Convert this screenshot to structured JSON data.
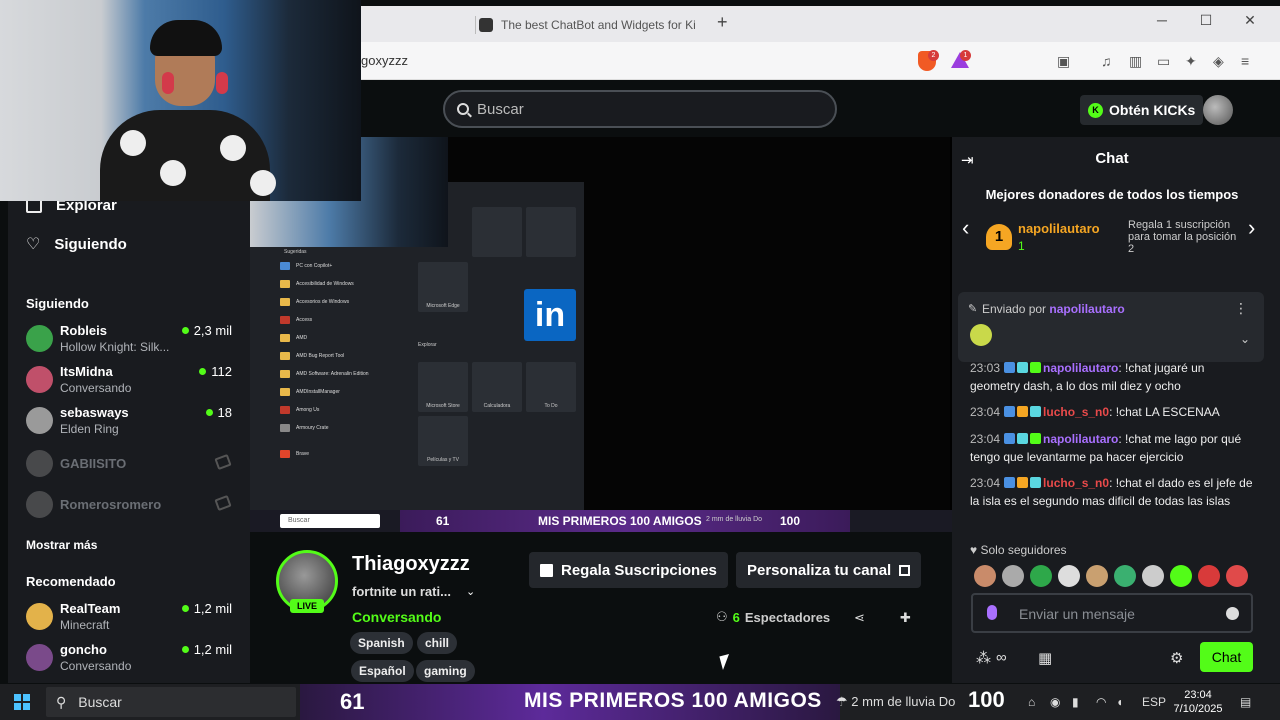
{
  "browser": {
    "tab_title": "The best ChatBot and Widgets for Ki",
    "new_tab": "+",
    "url": "goxyzzz",
    "minimize": "─",
    "maximize": "☐",
    "close": "✕",
    "brave_badge": "2",
    "rewards_badge": "1"
  },
  "header": {
    "search_placeholder": "Buscar",
    "kicks_button": "Obtén KICKs",
    "kicks_logo": "K"
  },
  "sidebar": {
    "explore": "Explorar",
    "following": "Siguiendo",
    "following_title": "Siguiendo",
    "following_channels": [
      {
        "name": "Robleis",
        "sub": "Hollow Knight: Silk...",
        "count": "2,3 mil",
        "avatar_color": "#3aa24a"
      },
      {
        "name": "ItsMidna",
        "sub": "Conversando",
        "count": "112",
        "avatar_color": "#c0506a"
      },
      {
        "name": "sebasways",
        "sub": "Elden Ring",
        "count": "18",
        "avatar_color": "#9a9a9a"
      }
    ],
    "offline_channels": [
      {
        "name": "GABIISITO"
      },
      {
        "name": "Romerosromero"
      }
    ],
    "show_more": "Mostrar más",
    "recommended_title": "Recomendado",
    "recommended_channels": [
      {
        "name": "RealTeam",
        "sub": "Minecraft",
        "count": "1,2 mil",
        "avatar_color": "#e3b24a"
      },
      {
        "name": "goncho",
        "sub": "Conversando",
        "count": "1,2 mil",
        "avatar_color": "#7a4a8a"
      }
    ]
  },
  "stream_overlay": {
    "start_menu_pinned": "Sugeridas",
    "start_menu_items": [
      "PC con Copilot+",
      "Accesibilidad de Windows",
      "Accesorios de Windows",
      "Access",
      "AMD",
      "AMD Bug Report Tool",
      "AMD Software: Adrenalin Edition",
      "AMDInstallManager",
      "Among Us",
      "Armoury Crate",
      "Brave"
    ],
    "tiles": [
      "Microsoft Edge",
      "Microsoft Store",
      "Calculadora",
      "To Do",
      "Películas y TV"
    ],
    "linkedin": "in",
    "explore_label": "Explorar",
    "stream_search": "Buscar",
    "stream_num": "61",
    "stream_banner": "MIS PRIMEROS 100 AMIGOS",
    "stream_100": "100",
    "stream_weather": "2 mm de lluvia Do"
  },
  "channel": {
    "name": "Thiagoxyzzz",
    "live_badge": "LIVE",
    "stream_title": "fortnite un rati...",
    "category": "Conversando",
    "tags": [
      "Spanish",
      "chill",
      "Español",
      "gaming"
    ],
    "subs_button": "Regala Suscripciones",
    "customize_button": "Personaliza tu canal",
    "viewer_count": "6",
    "viewers_label": "Espectadores"
  },
  "chat": {
    "title": "Chat",
    "donors_title": "Mejores donadores de todos los tiempos",
    "donor_rank": "1",
    "donor_name": "napolilautaro",
    "donor_amount": "1",
    "donor_next": "Regala 1 suscripción para tomar la posición 2",
    "pinned_prefix": "Enviado por",
    "pinned_user": "napolilautaro",
    "messages": [
      {
        "time": "23:03",
        "user": "napolilautaro",
        "text": ": !chat jugaré un geometry dash, a lo dos mil diez y ocho",
        "color": "purple"
      },
      {
        "time": "23:04",
        "user": "lucho_s_n0",
        "text": ": !chat LA ESCENAA",
        "color": "red"
      },
      {
        "time": "23:04",
        "user": "napolilautaro",
        "text": ": !chat me lago por qué tengo que levantarme pa hacer ejercicio",
        "color": "purple"
      },
      {
        "time": "23:04",
        "user": "lucho_s_n0",
        "text": ": !chat el dado es el jefe de la isla es el segundo mas dificil de todas las islas",
        "color": "red"
      }
    ],
    "followers_only": "Solo seguidores",
    "input_placeholder": "Enviar un mensaje",
    "send_button": "Chat"
  },
  "taskbar": {
    "search": "Buscar",
    "banner_num": "61",
    "banner_text": "MIS PRIMEROS 100 AMIGOS",
    "weather": "2 mm de lluvia Do",
    "banner_100": "100",
    "lang": "ESP",
    "time": "23:04",
    "date": "7/10/2025"
  },
  "colors": {
    "accent": "#53fc18",
    "panel": "#191b1f",
    "purple_user": "#a970ff",
    "red_user": "#e94a4a"
  }
}
